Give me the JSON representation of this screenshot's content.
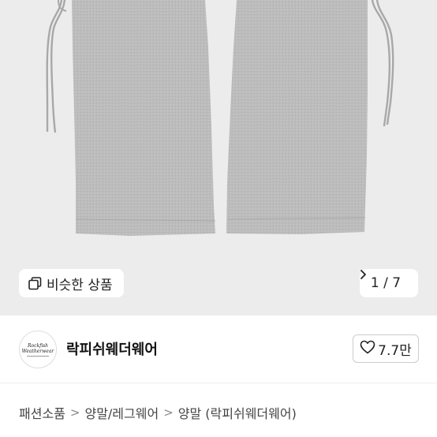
{
  "gallery": {
    "similar_label": "비슷한 상품",
    "current": "1",
    "separator": "/",
    "total": "7",
    "next_icon": "chevron-right-icon",
    "similar_icon": "copy-squares-icon"
  },
  "seller": {
    "name": "락피쉬웨더웨어",
    "avatar_line1": "Rockfish",
    "avatar_line2": "Weatherwear",
    "likes": "7.7만",
    "like_icon": "heart-outline-icon"
  },
  "breadcrumb": {
    "items": [
      "패션소품",
      "양말/레그웨어",
      "양말 (락피쉬웨더웨어)"
    ],
    "separator": ">"
  },
  "colors": {
    "photo_bg": "#ececec",
    "fabric": "#b9b9b9"
  }
}
